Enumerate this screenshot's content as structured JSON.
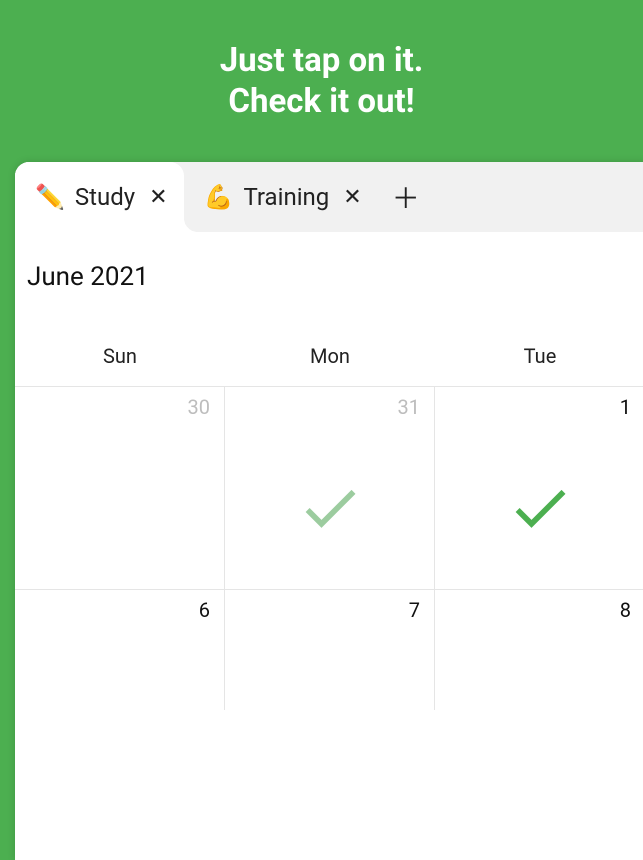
{
  "hero": {
    "line1": "Just tap on it.",
    "line2": "Check it out!"
  },
  "tabs": [
    {
      "emoji": "✏️",
      "label": "Study",
      "active": true
    },
    {
      "emoji": "💪",
      "label": "Training",
      "active": false
    }
  ],
  "month_title": "June 2021",
  "weekdays": [
    "Sun",
    "Mon",
    "Tue"
  ],
  "rows": [
    [
      {
        "num": "30",
        "muted": true,
        "check": null
      },
      {
        "num": "31",
        "muted": true,
        "check": "faded"
      },
      {
        "num": "1",
        "muted": false,
        "check": "full"
      }
    ],
    [
      {
        "num": "6",
        "muted": false,
        "check": null
      },
      {
        "num": "7",
        "muted": false,
        "check": null
      },
      {
        "num": "8",
        "muted": false,
        "check": null
      }
    ]
  ]
}
